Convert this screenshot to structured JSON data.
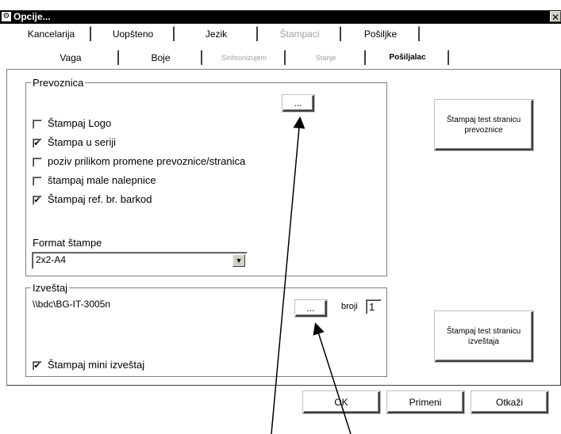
{
  "window": {
    "title": "Opcije...",
    "close_glyph": "✕",
    "icon": "app-icon"
  },
  "tabs_row1": [
    "Kancelarija",
    "Uopšteno",
    "Jezik",
    "Štampaci",
    "Pošiljke"
  ],
  "tabs_row2": [
    "Vaga",
    "Boje",
    "Sinhronizujem",
    "Stanje",
    "Pošiljalac"
  ],
  "prevoznica": {
    "legend": "Prevoznica",
    "browse_label": "...",
    "options": [
      {
        "label": "Štampaj Logo",
        "checked": false
      },
      {
        "label": "Štampa u seriji",
        "checked": true
      },
      {
        "label": "poziv prilikom promene prevoznice/stranica",
        "checked": false
      },
      {
        "label": "štampaj male nalepnice",
        "checked": false
      },
      {
        "label": "Štampaj ref. br. barkod",
        "checked": true
      }
    ],
    "format_label": "Format štampe",
    "format_value": "2x2-A4",
    "test_button": "Štampaj test stranicu prevoznice"
  },
  "izvestaj": {
    "legend": "Izveštaj",
    "printer_path": "\\\\bdc\\BG-IT-3005n",
    "browse_label": "...",
    "copies_label": "broji",
    "copies_value": "1",
    "mini_label": "Štampaj mini izveštaj",
    "mini_checked": true,
    "test_button": "Štampaj test stranicu izveštaja"
  },
  "footer": {
    "ok": "OK",
    "apply": "Primeni",
    "cancel": "Otkaži"
  },
  "check_glyph": "✔"
}
